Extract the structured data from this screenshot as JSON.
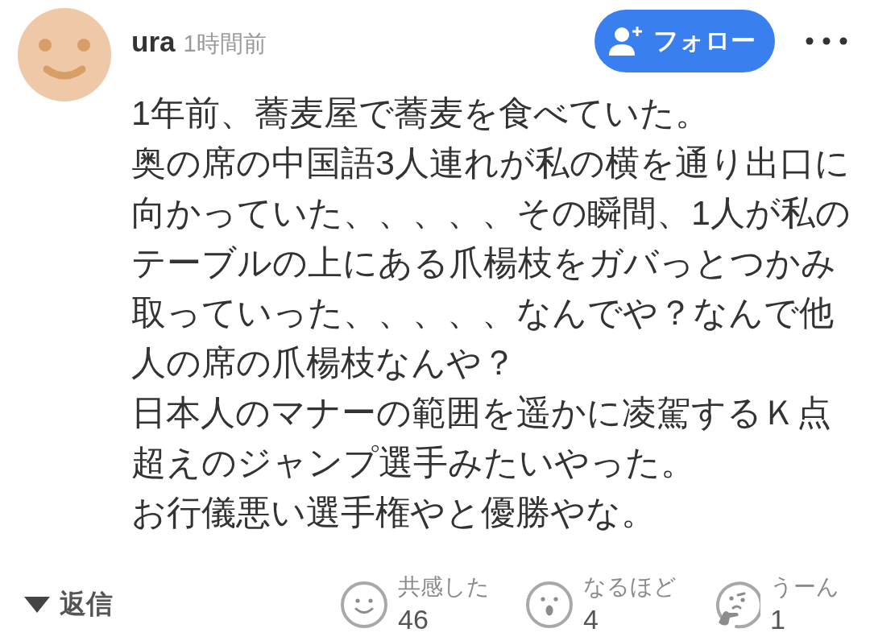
{
  "comment": {
    "author": {
      "name": "ura",
      "time": "1時間前"
    },
    "follow_button": {
      "label": "フォロー"
    },
    "body": [
      "1年前、蕎麦屋で蕎麦を食べていた。",
      "奥の席の中国語3人連れが私の横を通り出口に向かっていた、、、、、その瞬間、1人が私のテーブルの上にある爪楊枝をガバっとつかみ取っていった、、、、、なんでや？なんで他人の席の爪楊枝なんや？",
      "日本人のマナーの範囲を遥かに凌駕するＫ点超えのジャンプ選手みたいやった。",
      "お行儀悪い選手権やと優勝やな。"
    ],
    "reply_toggle": {
      "label": "返信"
    },
    "reactions": [
      {
        "kind": "smile",
        "label": "共感した",
        "count": "46",
        "selected": false
      },
      {
        "kind": "surprised",
        "label": "なるほど",
        "count": "4",
        "selected": false
      },
      {
        "kind": "thinking",
        "label": "うーん",
        "count": "1",
        "selected": false
      }
    ]
  }
}
